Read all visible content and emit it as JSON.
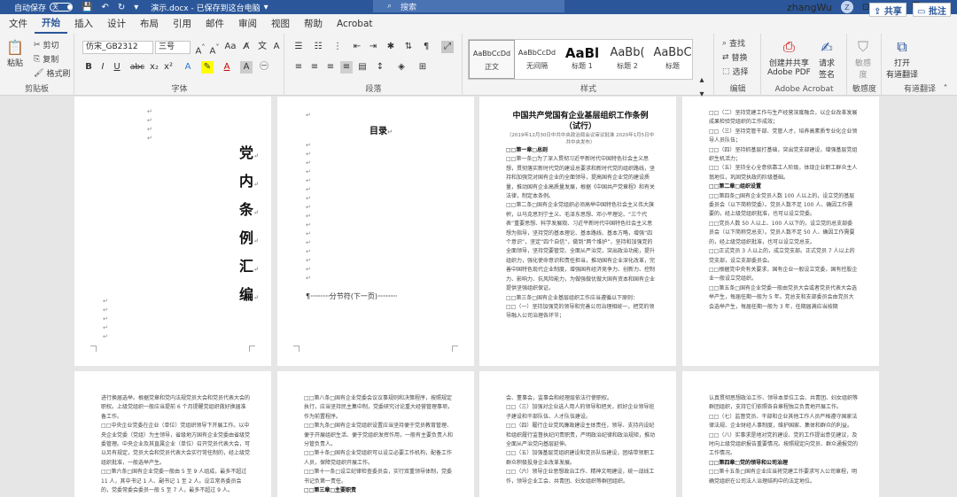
{
  "titlebar": {
    "autosave_label": "自动保存",
    "autosave_state": "关",
    "doc_title": "演示.docx - 已保存到这台电脑",
    "search_placeholder": "搜索",
    "user_name": "zhangWu",
    "user_initial": "Z"
  },
  "tabs": [
    "文件",
    "开始",
    "插入",
    "设计",
    "布局",
    "引用",
    "邮件",
    "审阅",
    "视图",
    "帮助",
    "Acrobat"
  ],
  "active_tab": "开始",
  "share_label": "共享",
  "comment_label": "批注",
  "ribbon": {
    "clipboard": {
      "paste": "粘贴",
      "cut": "剪切",
      "copy": "复制",
      "format_painter": "格式刷",
      "label": "剪贴板"
    },
    "font": {
      "font_name": "仿宋_GB2312",
      "font_size": "三号",
      "bold": "B",
      "italic": "I",
      "underline": "U",
      "strike": "abc",
      "sub": "x₂",
      "sup": "x²",
      "label": "字体"
    },
    "paragraph": {
      "label": "段落"
    },
    "styles": {
      "items": [
        {
          "sample": "AaBbCcDd",
          "name": "正文"
        },
        {
          "sample": "AaBbCcDd",
          "name": "无间隔"
        },
        {
          "sample": "AaBl",
          "name": "标题 1"
        },
        {
          "sample": "AaBb(",
          "name": "标题 2"
        },
        {
          "sample": "AaBbC",
          "name": "标题"
        }
      ],
      "label": "样式"
    },
    "editing": {
      "find": "查找",
      "replace": "替换",
      "select": "选择",
      "label": "编辑"
    },
    "acrobat": {
      "create": "创建并共享",
      "create2": "Adobe PDF",
      "request": "请求",
      "request2": "签名",
      "label": "Adobe Acrobat"
    },
    "sensitivity": {
      "label_btn": "敏感",
      "label_btn2": "度",
      "label": "敏感度"
    },
    "audit": {
      "open": "打开",
      "open2": "有道翻译",
      "label": "有道翻译"
    }
  },
  "pages": {
    "cover_chars": [
      "党",
      "内",
      "条",
      "例",
      "汇",
      "编"
    ],
    "toc_title": "目录",
    "section_break": "分节符(下一页)",
    "page3_title": "中国共产党国有企业基层组织工作条例（试行）",
    "page3_sub": "（2019年12月30日中共中央政治局会议审议批准 2020年1月5日中共中央发布）",
    "page3_lines": [
      "□□第一章□总则",
      "□□第一条□为了深入贯彻习近平新时代中国特色社会主义思想，贯彻落实新时代党的建设总要求和新时代党的组织路线，坚持和加强党对国有企业的全面领导，提高国有企业党的建设质量，推动国有企业高质量发展，根据《中国共产党章程》和有关法律，制定本条例。",
      "□□第二条□国有企业党组织必须高举中国特色社会主义伟大旗帜，以马克思列宁主义、毛泽东思想、邓小平理论、“三个代表”重要思想、科学发展观、习近平新时代中国特色社会主义思想为指导，坚持党的基本理论、基本路线、基本方略，增强“四个意识”，坚定“四个自信”，做到“两个维护”，坚持和加强党的全面领导，坚持党要管党、全面从严治党，突出政治功能，提升组织力，强化使命意识和责任担当，推动国有企业深化改革，完善中国特色现代企业制度，增强国有经济竞争力、创新力、控制力、影响力、抗风险能力，为做强做优做大国有资本和国有企业提供坚强组织保证。",
      "□□第三条□国有企业基层组织工作应当遵循以下原则：",
      "□□（一）坚持加强党的领导和完善公司治理相统一，把党的领导融入公司治理各环节；"
    ],
    "page4_lines": [
      "□□（二）坚持党建工作与生产经营深度融合，以企业改革发展成果检验党组织的工作成效；",
      "□□（三）坚持党管干部、党管人才，培养高素质专业化企业领导人员队伍；",
      "□□（四）坚持抓基层打基础，突出党支部建设，增强基层党组织生机活力；",
      "□□（五）坚持全心全意依靠工人阶级，体现企业职工群众主人翁地位，巩固党执政的阶级基础。",
      "□□第二章□组织设置",
      "□□第四条□国有企业党员人数 100 人以上的，设立党的基层委员会（以下简称党委）。党员人数不足 100 人、确因工作需要的，经上级党组织批准，也可以设立党委。",
      "□□党员人数 50 人以上、100 人以下的，设立党的总支部委员会（以下简称党总支）。党员人数不足 50 人、确因工作需要的，经上级党组织批准，也可以设立党总支。",
      "□□正式党员 3 人以上的，成立党支部。正式党员 7 人以上的党支部，设立支部委员会。",
      "□□根据党中央有关要求，国有企业一般设立党委，国有控股企业一般设立党组织。",
      "□□第五条□国有企业党委一般由党员大会或者党员代表大会选举产生，每届任期一般为 5 年。党总支和支部委员会由党员大会选举产生，每届任期一般为 3 年，任期届满应当按期"
    ],
    "page5_lines": [
      "进行换届选举。根据党章和党内法规党员大会和党员代表大会的职权。上级党组织一般应当提前 6 个月提醒党组织做好换届准备工作。",
      "□□中央企业党委在企业（单位）党组织领导下开展工作。以中央企业党委（党组）为主领导，省级地方国有企业党委由省级党委管理。中央企业及其直属企业（单位）召开党员代表大会，可以另有规定，党员大会和党员代表大会实行常任制的，经上级党组织批准，一般选举产生。",
      "□□第六条□国有企业党委一般由 5 至 9 人组成，最多不超过 11 人，其中书记 1 人、副书记 1 至 2 人。设立常务委员会的，党委常委会委员一般 5 至 7 人，最多不超过 9 人。"
    ],
    "page6_lines": [
      "□□第八条□国有企业党委会议议事规则和决策程序，按照规定执行，应当坚持民主集中制，党委研究讨论重大经营管理事项，作为前置程序。",
      "□□第九条□国有企业党组织设置应当坚持便于党员教育管理、便于开展组织生活、便于党组织发挥作用，一般有主要负责人和分管负责人。",
      "□□第十条□国有企业党组织可以设立必要工作机构，配备工作人员，保障党组织开展工作。",
      "□□第十一条□设立纪律检查委员会，实行双重领导体制，党委书记负第一责任。",
      "□□第三章□主要职责"
    ],
    "page7_lines": [
      "会、董事会，监事会和经理层依法行使职权。",
      "□□（三）加强对企业选人用人的领导和把关，抓好企业领导班子建设和干部队伍、人才队伍建设。",
      "□□（四）履行企业党风廉政建设主体责任，领导、支持内设纪检组织履行监督执纪问责职责，严明政治纪律和政治规矩，推动全面从严治党向基层延伸。",
      "□□（五）加强基层党组织建设和党员队伍建设，团结带领职工群众积极投身企业改革发展。",
      "□□（六）领导企业思想政治工作、精神文明建设，统一战线工作，领导企业工会、共青团、妇女组织等群团组织。"
    ],
    "page8_lines": [
      "认真贯彻思想政治工作、领导本单位工会、共青团、妇女组织等群团组织，支持它们依照各自章程独立负责地开展工作。",
      "□□（七）监督党员、干部和企业其他工作人员严格遵守国家法律法规、企业财经人事制度，维护国家、集体和群众的利益。",
      "□□（八）实事求是地对党的建设、党的工作提出意见建议，及时向上级党组织报告重要情况。按照规定向党员、群众通报党的工作情况。",
      "□□第四章□党的领导和公司治理",
      "□□第十五条□国有企业应当将党建工作要求写入公司章程，明确党组织在公司法人治理结构中的法定地位。"
    ],
    "para_mark": "↵"
  }
}
